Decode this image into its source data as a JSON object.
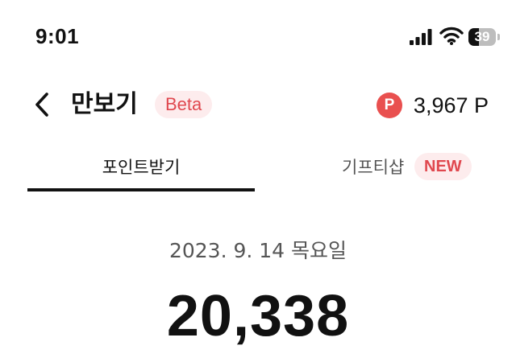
{
  "status_bar": {
    "time": "9:01",
    "battery_level": "39",
    "battery_fraction": 0.39,
    "icons": [
      "signal-icon",
      "wifi-icon",
      "battery-icon"
    ]
  },
  "header": {
    "title": "만보기",
    "beta_label": "Beta",
    "back_icon": "chevron-left-icon",
    "points_icon_letter": "P",
    "points_value": "3,967 P"
  },
  "tabs": [
    {
      "label": "포인트받기",
      "active": true
    },
    {
      "label": "기프티샵",
      "badge": "NEW",
      "active": false
    }
  ],
  "main": {
    "date": "2023. 9. 14 목요일",
    "step_count": "20,338"
  },
  "colors": {
    "accent": "#e9504f",
    "badge_background": "#fdeced",
    "badge_text": "#e0484f",
    "text_primary": "#111111",
    "text_secondary": "#555555"
  }
}
